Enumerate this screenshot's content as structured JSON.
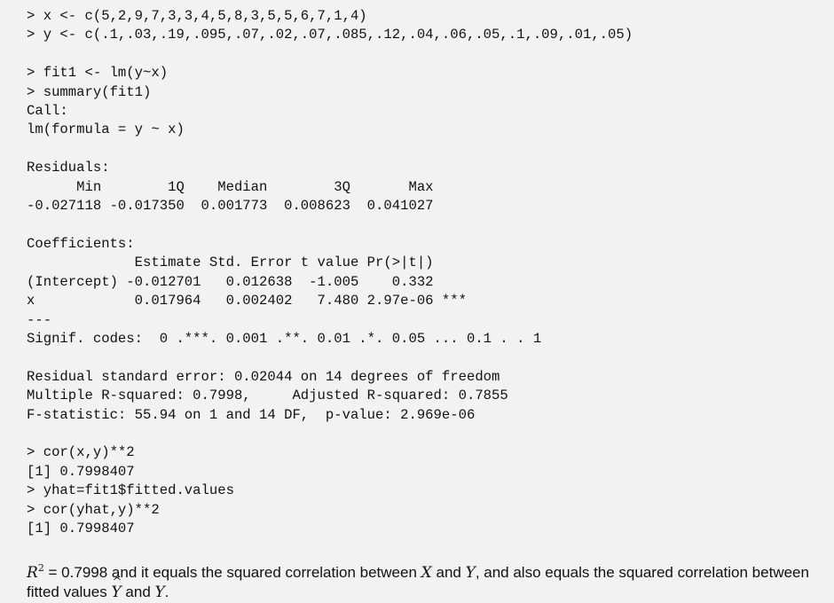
{
  "console": {
    "lines": [
      "> x <- c(5,2,9,7,3,3,4,5,8,3,5,5,6,7,1,4)",
      "> y <- c(.1,.03,.19,.095,.07,.02,.07,.085,.12,.04,.06,.05,.1,.09,.01,.05)",
      "",
      "> fit1 <- lm(y~x)",
      "> summary(fit1)",
      "Call:",
      "lm(formula = y ~ x)",
      "",
      "Residuals:",
      "      Min        1Q    Median        3Q       Max ",
      "-0.027118 -0.017350  0.001773  0.008623  0.041027 ",
      "",
      "Coefficients:",
      "             Estimate Std. Error t value Pr(>|t|)    ",
      "(Intercept) -0.012701   0.012638  -1.005    0.332    ",
      "x            0.017964   0.002402   7.480 2.97e-06 ***",
      "---",
      "Signif. codes:  0 .***. 0.001 .**. 0.01 .*. 0.05 ... 0.1 . . 1",
      "",
      "Residual standard error: 0.02044 on 14 degrees of freedom",
      "Multiple R-squared: 0.7998,     Adjusted R-squared: 0.7855 ",
      "F-statistic: 55.94 on 1 and 14 DF,  p-value: 2.969e-06",
      "",
      "> cor(x,y)**2",
      "[1] 0.7998407",
      "> yhat=fit1$fitted.values",
      "> cor(yhat,y)**2",
      "[1] 0.7998407"
    ]
  },
  "note": {
    "r_symbol": "R",
    "r_exponent": "2",
    "equals_value": " = 0.7998",
    "text_part1": " and it equals the squared correlation between ",
    "var_x": "X",
    "text_and1": " and ",
    "var_y1": "Y",
    "text_part2": ", and also equals the squared correlation between fitted values ",
    "var_yhat": "Y",
    "text_and2": " and ",
    "var_y2": "Y",
    "text_end": "."
  }
}
